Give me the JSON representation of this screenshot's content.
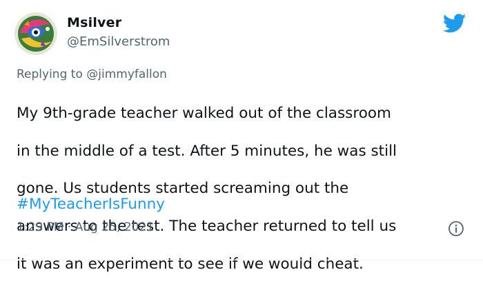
{
  "tweet": {
    "display_name": "Msilver",
    "handle": "@EmSilverstrom",
    "reply_prefix": "Replying to ",
    "reply_to": "@jimmyfallon",
    "text_lines": [
      "My 9th-grade teacher walked out of the classroom",
      "in the middle of a test. After 5 minutes, he was still",
      "gone. Us students started screaming out the",
      "answers to the test. The teacher returned to tell us",
      "it was an experiment to see if we would cheat."
    ],
    "hashtag": "#MyTeacherIsFunny",
    "timestamp": "1:29 PM · Aug 25, 2021"
  },
  "icons": {
    "brand": "twitter-bird-icon",
    "info": "info-icon",
    "avatar": "avatar-image"
  },
  "colors": {
    "brand_blue": "#1d9bf0",
    "text": "#0f1419",
    "secondary_text": "#536471"
  }
}
